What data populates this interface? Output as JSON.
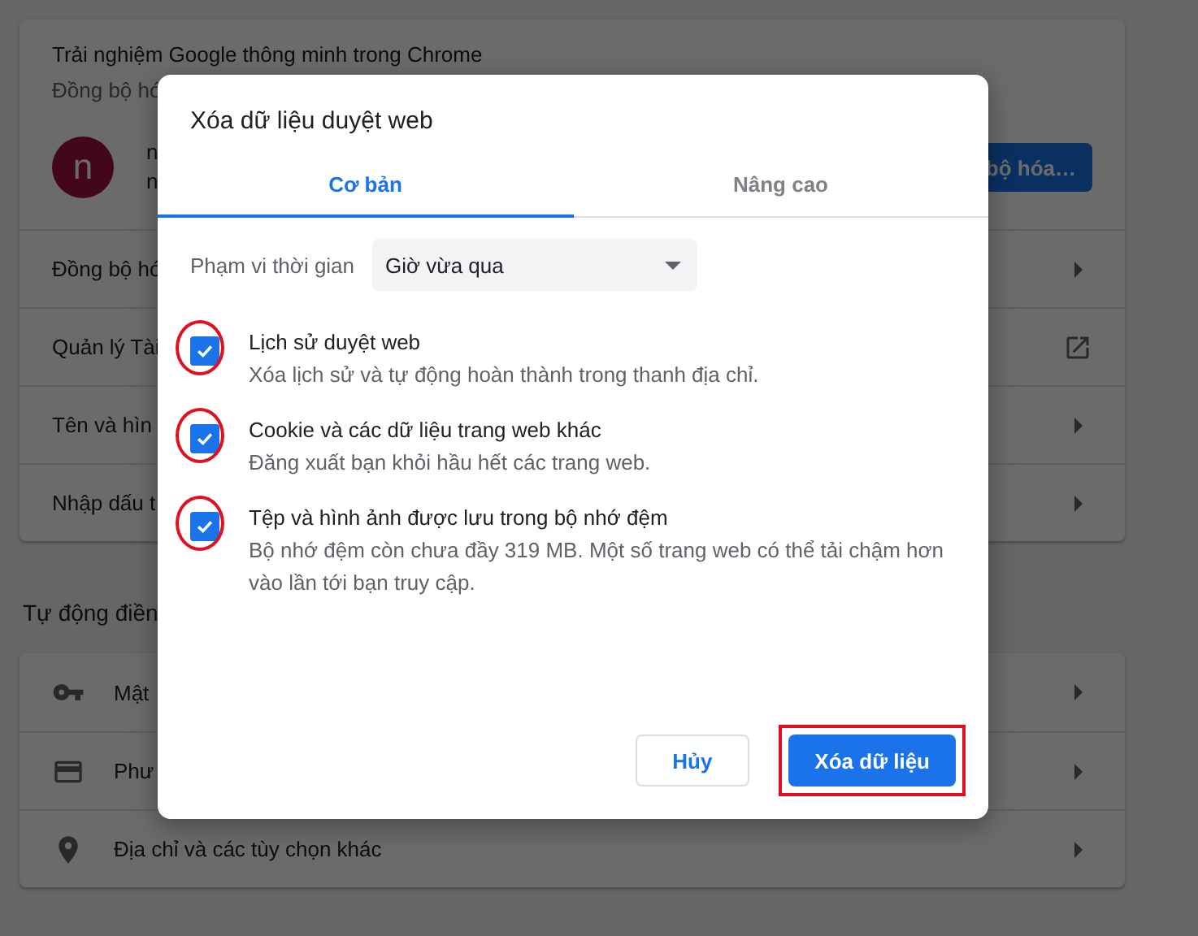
{
  "page": {
    "sync_card": {
      "title": "Trải nghiệm Google thông minh trong Chrome",
      "subtitle": "Đồng bộ hó",
      "avatar_letter": "n",
      "account_lines": [
        "n",
        "n"
      ],
      "sync_button": "bộ hóa…"
    },
    "settings_rows": [
      {
        "label": "Đồng bộ hó",
        "kind": "arrow"
      },
      {
        "label": "Quản lý Tài",
        "kind": "external"
      },
      {
        "label": "Tên và hìn",
        "kind": "arrow"
      },
      {
        "label": "Nhập dấu t",
        "kind": "arrow"
      }
    ],
    "autofill_heading": "Tự động điền",
    "autofill_rows": [
      {
        "label": "Mật",
        "kind": "key"
      },
      {
        "label": "Phư",
        "kind": "card"
      },
      {
        "label": "Địa chỉ và các tùy chọn khác",
        "kind": "pin"
      }
    ]
  },
  "dialog": {
    "title": "Xóa dữ liệu duyệt web",
    "tabs": [
      {
        "label": "Cơ bản",
        "selected": true
      },
      {
        "label": "Nâng cao",
        "selected": false
      }
    ],
    "time_range": {
      "label": "Phạm vi thời gian",
      "value": "Giờ vừa qua"
    },
    "options": [
      {
        "title": "Lịch sử duyệt web",
        "description": "Xóa lịch sử và tự động hoàn thành trong thanh địa chỉ.",
        "checked": true,
        "highlighted": true
      },
      {
        "title": "Cookie và các dữ liệu trang web khác",
        "description": "Đăng xuất bạn khỏi hầu hết các trang web.",
        "checked": true,
        "highlighted": true
      },
      {
        "title": "Tệp và hình ảnh được lưu trong bộ nhớ đệm",
        "description": "Bộ nhớ đệm còn chưa đầy 319 MB. Một số trang web có thể tải chậm hơn vào lần tới bạn truy cập.",
        "checked": true,
        "highlighted": true
      }
    ],
    "cancel_button": {
      "label": "Hủy"
    },
    "confirm_button": {
      "label": "Xóa dữ liệu",
      "highlighted": true
    }
  }
}
